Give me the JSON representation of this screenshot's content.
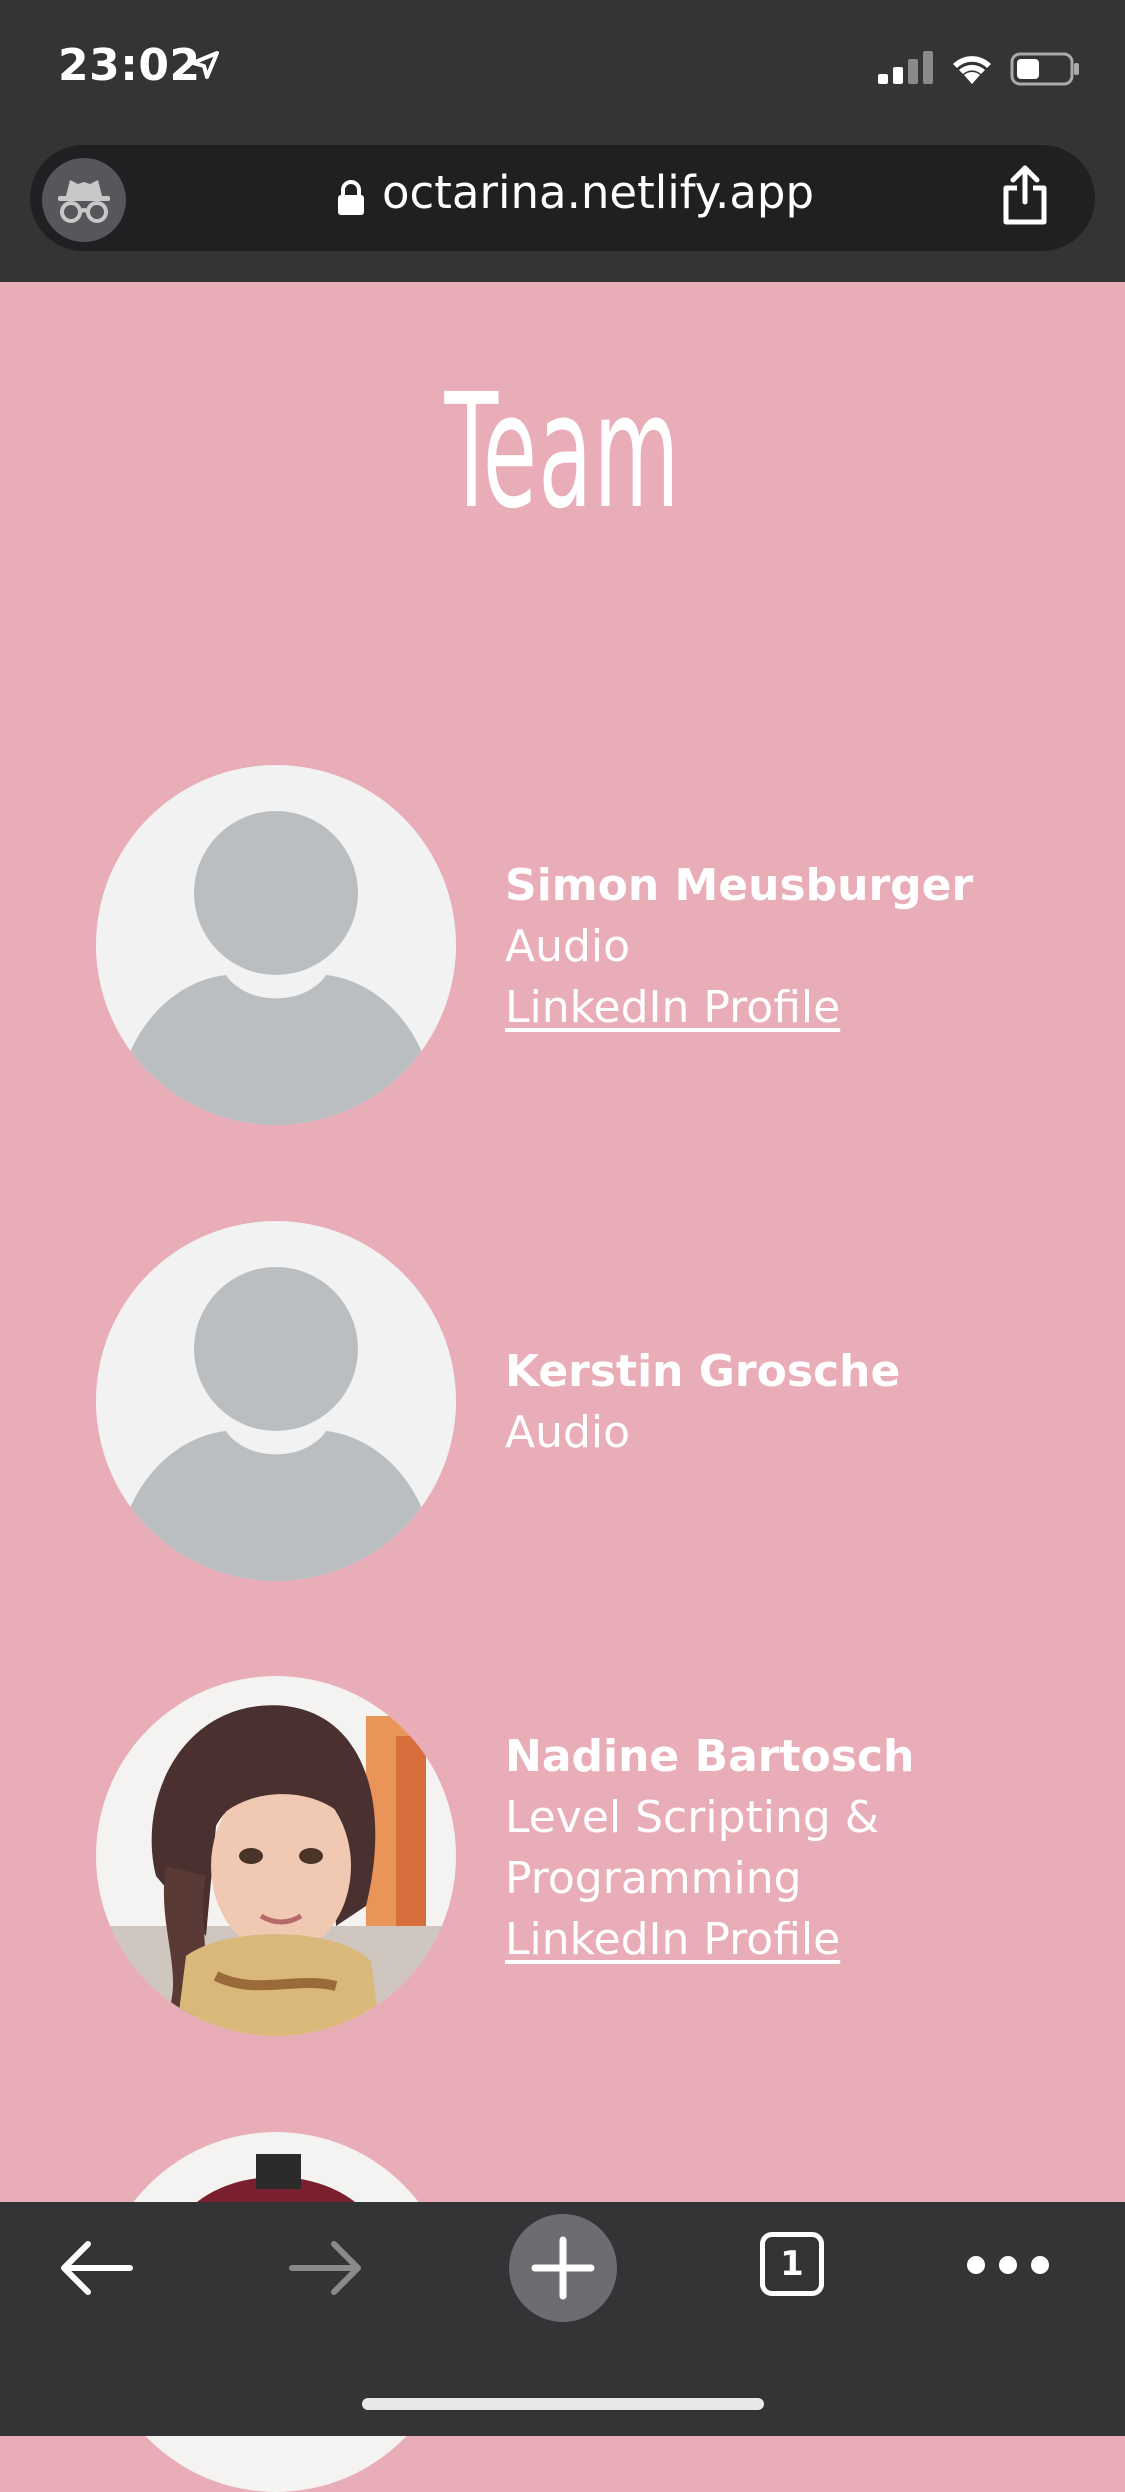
{
  "status_bar": {
    "time": "23:02"
  },
  "browser": {
    "url": "octarina.netlify.app",
    "tab_count": "1"
  },
  "page": {
    "title": "Team",
    "members": [
      {
        "name": "Simon Meusburger",
        "role": "Audio",
        "link": "LinkedIn Profile",
        "avatar": "placeholder-avatar"
      },
      {
        "name": "Kerstin Grosche",
        "role": "Audio",
        "link": "",
        "avatar": "placeholder-avatar"
      },
      {
        "name": "Nadine Bartosch",
        "role_line1": "Level Scripting &",
        "role_line2": "Programming",
        "link": "LinkedIn Profile",
        "avatar": "photo"
      }
    ]
  },
  "colors": {
    "page_background": "#e8adb7",
    "chrome_background": "#333436",
    "text": "#ffffff"
  }
}
